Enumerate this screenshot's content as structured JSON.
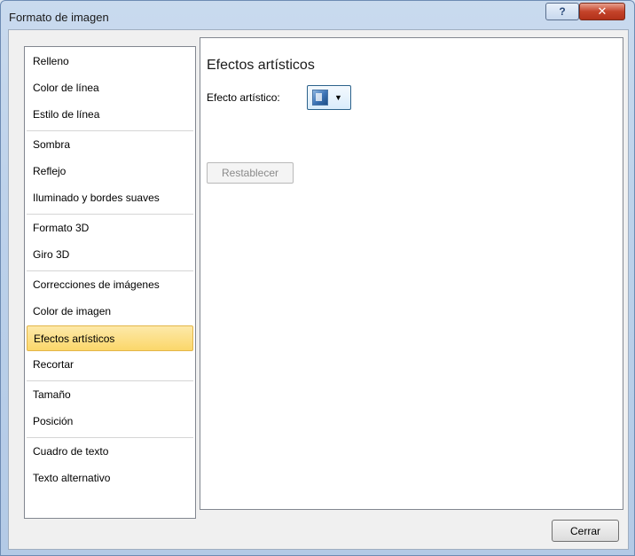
{
  "window": {
    "title": "Formato de imagen",
    "help_glyph": "?",
    "close_glyph": "✕"
  },
  "nav": {
    "items": [
      {
        "label": "Relleno"
      },
      {
        "label": "Color de línea"
      },
      {
        "label": "Estilo de línea"
      },
      {
        "label": "Sombra"
      },
      {
        "label": "Reflejo"
      },
      {
        "label": "Iluminado y bordes suaves"
      },
      {
        "label": "Formato 3D"
      },
      {
        "label": "Giro 3D"
      },
      {
        "label": "Correcciones de imágenes"
      },
      {
        "label": "Color de imagen"
      },
      {
        "label": "Efectos artísticos",
        "selected": true
      },
      {
        "label": "Recortar"
      },
      {
        "label": "Tamaño"
      },
      {
        "label": "Posición"
      },
      {
        "label": "Cuadro de texto"
      },
      {
        "label": "Texto alternativo"
      }
    ]
  },
  "panel": {
    "title": "Efectos artísticos",
    "effect_label": "Efecto artístico:",
    "effect_icon": "artistic-effect-icon",
    "reset_label": "Restablecer",
    "reset_enabled": false
  },
  "footer": {
    "close_label": "Cerrar"
  },
  "colors": {
    "selected_bg": "#fbd76a",
    "selected_border": "#e3b649",
    "close_button_red": "#c4432a"
  }
}
